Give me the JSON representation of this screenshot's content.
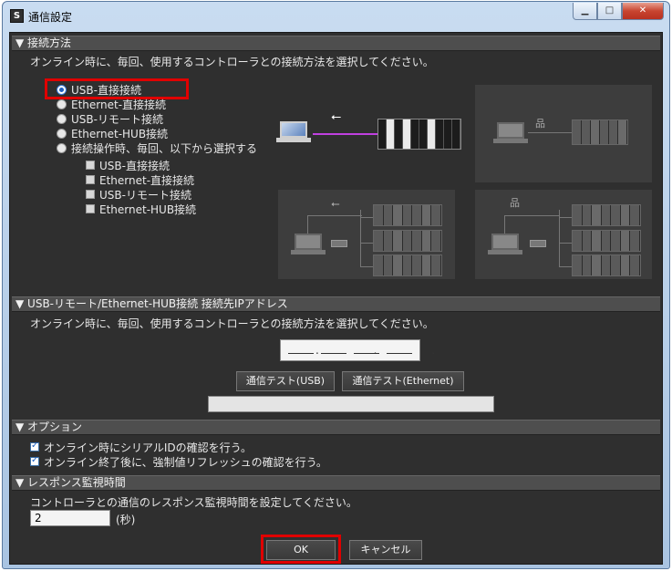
{
  "window": {
    "title": "通信設定",
    "icon_glyph": "S",
    "minimize_glyph": "▁",
    "maximize_glyph": "□",
    "close_glyph": "✕"
  },
  "section_connection": {
    "header": "▼ 接続方法",
    "instruction": "オンライン時に、毎回、使用するコントローラとの接続方法を選択してください。",
    "options": [
      {
        "label": "USB-直接接続",
        "selected": true
      },
      {
        "label": "Ethernet-直接接続",
        "selected": false
      },
      {
        "label": "USB-リモート接続",
        "selected": false
      },
      {
        "label": "Ethernet-HUB接続",
        "selected": false
      },
      {
        "label": "接続操作時、毎回、以下から選択する",
        "selected": false
      }
    ],
    "sub_options": [
      {
        "label": "USB-直接接続",
        "checked": false
      },
      {
        "label": "Ethernet-直接接続",
        "checked": false
      },
      {
        "label": "USB-リモート接続",
        "checked": false
      },
      {
        "label": "Ethernet-HUB接続",
        "checked": false
      }
    ],
    "usb_glyph": "⭠",
    "ethernet_glyph": "品"
  },
  "section_ip": {
    "header": "▼ USB-リモート/Ethernet-HUB接続 接続先IPアドレス",
    "instruction": "オンライン時に、毎回、使用するコントローラとの接続方法を選択してください。",
    "ip_dots": ". . .",
    "test_usb_button": "通信テスト(USB)",
    "test_ethernet_button": "通信テスト(Ethernet)",
    "result_text": ""
  },
  "section_options": {
    "header": "▼ オプション",
    "items": [
      {
        "label": "オンライン時にシリアルIDの確認を行う。",
        "checked": true
      },
      {
        "label": "オンライン終了後に、強制値リフレッシュの確認を行う。",
        "checked": true
      }
    ]
  },
  "section_timeout": {
    "header": "▼ レスポンス監視時間",
    "instruction": "コントローラとの通信のレスポンス監視時間を設定してください。",
    "value": "2",
    "unit": "(秒)"
  },
  "footer": {
    "ok_button": "OK",
    "cancel_button": "キャンセル"
  },
  "colors": {
    "highlight_red": "#e00000",
    "usb_line": "#c040e0"
  }
}
